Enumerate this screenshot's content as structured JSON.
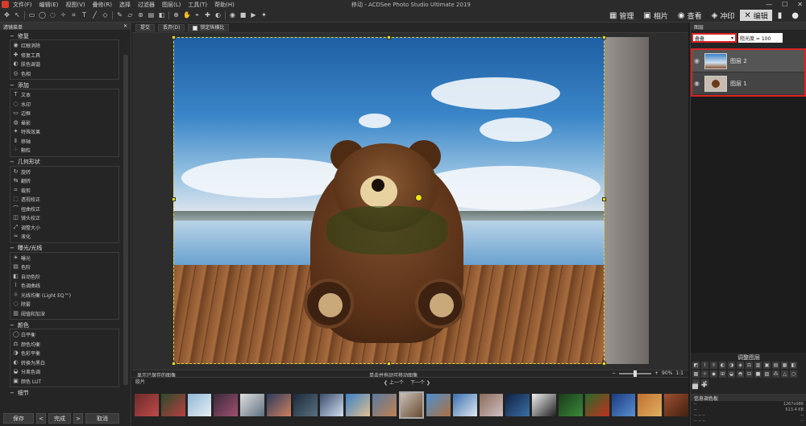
{
  "window": {
    "title": "移动 - ACDSee Photo Studio Ultimate 2019",
    "menu": [
      "文件(F)",
      "编辑(E)",
      "视图(V)",
      "叠修(R)",
      "选择",
      "过滤器",
      "图层(L)",
      "工具(T)",
      "帮助(H)"
    ],
    "controls": [
      "—",
      "☐",
      "✕"
    ]
  },
  "modes": [
    {
      "icon": "grid-icon",
      "glyph": "▦",
      "label": "管理"
    },
    {
      "icon": "photos-icon",
      "glyph": "▣",
      "label": "相片"
    },
    {
      "icon": "view-eye-icon",
      "glyph": "◉",
      "label": "查看"
    },
    {
      "icon": "develop-icon",
      "glyph": "◈",
      "label": "冲印"
    },
    {
      "icon": "edit-tools-icon",
      "glyph": "✕",
      "label": "编辑"
    },
    {
      "icon": "chart-icon",
      "glyph": "▮",
      "label": ""
    },
    {
      "icon": "user-icon",
      "glyph": "●",
      "label": ""
    }
  ],
  "left_panel": {
    "title": "滤镜菜单",
    "groups": [
      {
        "title": "修复",
        "items": [
          "红眼消除",
          "修复工具",
          "肤色调谐",
          "色相"
        ]
      },
      {
        "title": "添加",
        "items": [
          "文本",
          "水印",
          "边框",
          "晕影",
          "特殊效果",
          "移轴",
          "颗粒"
        ]
      },
      {
        "title": "几何形状",
        "items": [
          "旋转",
          "翻转",
          "裁剪",
          "透视校正",
          "扭曲校正",
          "镜头校正",
          "调整大小",
          "液化"
        ]
      },
      {
        "title": "曝光/光线",
        "items": [
          "曝光",
          "色阶",
          "自动色阶",
          "色调曲线",
          "光线均衡 (Light EQ™)",
          "除雾",
          "阈值和加深"
        ]
      },
      {
        "title": "颜色",
        "items": [
          "白平衡",
          "颜色均衡",
          "色彩平衡",
          "转换为黑白",
          "分离色调",
          "颜色 LUT"
        ]
      },
      {
        "title": "细节",
        "items": []
      }
    ],
    "buttons": {
      "save": "保存",
      "prev": "<",
      "done": "完成",
      "next": ">",
      "cancel": "取消"
    }
  },
  "canvas": {
    "tabs": [
      "提交",
      "丢弃(D)",
      "锁定纵横比"
    ],
    "status_left": "显示已保存的图像",
    "status_center": "单击并拖动可移动图像",
    "zoom": "90%",
    "ratio": "1:1"
  },
  "filmstrip": {
    "title": "胶片",
    "prev": "上一个",
    "next": "下一个",
    "thumbs": [
      {
        "colors": [
          "#6b2a2a",
          "#c04a4a"
        ]
      },
      {
        "colors": [
          "#2a4a2a",
          "#b84040"
        ]
      },
      {
        "colors": [
          "#8fb8d8",
          "#e8eef4"
        ]
      },
      {
        "colors": [
          "#3a2a3a",
          "#a05070"
        ]
      },
      {
        "colors": [
          "#e0e0e0",
          "#607080"
        ]
      },
      {
        "colors": [
          "#2a3a5a",
          "#d08060"
        ]
      },
      {
        "colors": [
          "#1a2a3a",
          "#5a7080"
        ]
      },
      {
        "colors": [
          "#3a4a6a",
          "#d0e0f0"
        ]
      },
      {
        "colors": [
          "#3a80c8",
          "#e0c090"
        ]
      },
      {
        "colors": [
          "#5a7aa0",
          "#c08050"
        ]
      },
      {
        "colors": [
          "#c8c0b8",
          "#6a4a30"
        ],
        "selected": true
      },
      {
        "colors": [
          "#4a90d0",
          "#b07040"
        ]
      },
      {
        "colors": [
          "#3a70b0",
          "#e0e8f0"
        ]
      },
      {
        "colors": [
          "#8a6a5a",
          "#d0c0c0"
        ]
      },
      {
        "colors": [
          "#102040",
          "#3a70a8"
        ]
      },
      {
        "colors": [
          "#f0f0f0",
          "#202020"
        ]
      },
      {
        "colors": [
          "#1a3a1a",
          "#3a8a3a"
        ]
      },
      {
        "colors": [
          "#2a6a2a",
          "#c03020"
        ]
      },
      {
        "colors": [
          "#1a3a80",
          "#5a90d0"
        ]
      },
      {
        "colors": [
          "#c07030",
          "#e0b060"
        ]
      },
      {
        "colors": [
          "#a05030",
          "#402010"
        ]
      }
    ]
  },
  "right_panel": {
    "title": "图层",
    "blend_mode": "叠叠",
    "opacity": "阻光度 = 100",
    "layers": [
      {
        "name": "图层 2"
      },
      {
        "name": "图层 1"
      }
    ],
    "adjust_title": "调整图层",
    "info_title": "信息调色板",
    "info_rows": [
      {
        "k": "--",
        "v": "1267x986"
      },
      {
        "k": "--",
        "v": "513.4 KB"
      },
      {
        "k": "--  --  --",
        "v": "--"
      },
      {
        "k": "--  --  --",
        "v": "--"
      }
    ]
  },
  "accent": {
    "selection": "#f2e30a",
    "highlight": "#dd2222"
  }
}
